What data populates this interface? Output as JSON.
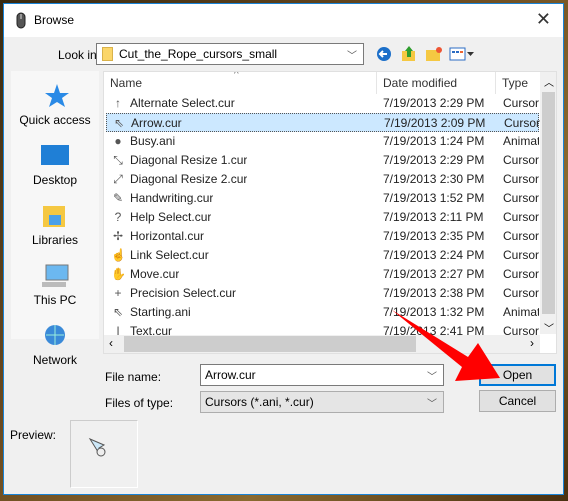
{
  "window": {
    "title": "Browse",
    "icon": "mouse-icon",
    "close": "✕"
  },
  "look_in": {
    "label": "Look in:",
    "value": "Cut_the_Rope_cursors_small"
  },
  "toolbar": {
    "icons": [
      "back-icon",
      "up-folder-icon",
      "new-folder-icon",
      "view-menu-icon"
    ]
  },
  "sidebar": {
    "items": [
      {
        "label": "Quick access",
        "icon": "star-icon"
      },
      {
        "label": "Desktop",
        "icon": "desktop-icon"
      },
      {
        "label": "Libraries",
        "icon": "libraries-icon"
      },
      {
        "label": "This PC",
        "icon": "computer-icon"
      },
      {
        "label": "Network",
        "icon": "network-icon"
      }
    ]
  },
  "columns": [
    "Name",
    "Date modified",
    "Type"
  ],
  "files": [
    {
      "name": "Alternate Select.cur",
      "date": "7/19/2013 2:29 PM",
      "type": "Cursor",
      "icon": "↑"
    },
    {
      "name": "Arrow.cur",
      "date": "7/19/2013 2:09 PM",
      "type": "Cursor",
      "icon": "⇖",
      "selected": true
    },
    {
      "name": "Busy.ani",
      "date": "7/19/2013 1:24 PM",
      "type": "Animated",
      "icon": "●"
    },
    {
      "name": "Diagonal Resize 1.cur",
      "date": "7/19/2013 2:29 PM",
      "type": "Cursor",
      "icon": "⤡"
    },
    {
      "name": "Diagonal Resize 2.cur",
      "date": "7/19/2013 2:30 PM",
      "type": "Cursor",
      "icon": "⤢"
    },
    {
      "name": "Handwriting.cur",
      "date": "7/19/2013 1:52 PM",
      "type": "Cursor",
      "icon": "✎"
    },
    {
      "name": "Help Select.cur",
      "date": "7/19/2013 2:11 PM",
      "type": "Cursor",
      "icon": "?"
    },
    {
      "name": "Horizontal.cur",
      "date": "7/19/2013 2:35 PM",
      "type": "Cursor",
      "icon": "✢"
    },
    {
      "name": "Link Select.cur",
      "date": "7/19/2013 2:24 PM",
      "type": "Cursor",
      "icon": "☝"
    },
    {
      "name": "Move.cur",
      "date": "7/19/2013 2:27 PM",
      "type": "Cursor",
      "icon": "✋"
    },
    {
      "name": "Precision Select.cur",
      "date": "7/19/2013 2:38 PM",
      "type": "Cursor",
      "icon": "+"
    },
    {
      "name": "Starting.ani",
      "date": "7/19/2013 1:32 PM",
      "type": "Animated",
      "icon": "⇖"
    },
    {
      "name": "Text.cur",
      "date": "7/19/2013 2:41 PM",
      "type": "Cursor",
      "icon": "I"
    }
  ],
  "file_name": {
    "label": "File name:",
    "value": "Arrow.cur"
  },
  "file_type": {
    "label": "Files of type:",
    "value": "Cursors (*.ani, *.cur)"
  },
  "buttons": {
    "open": "Open",
    "cancel": "Cancel"
  },
  "preview": {
    "label": "Preview:"
  },
  "colors": {
    "accent": "#0078d7",
    "annotation_arrow": "#ff0000",
    "selection": "#cce8ff"
  }
}
